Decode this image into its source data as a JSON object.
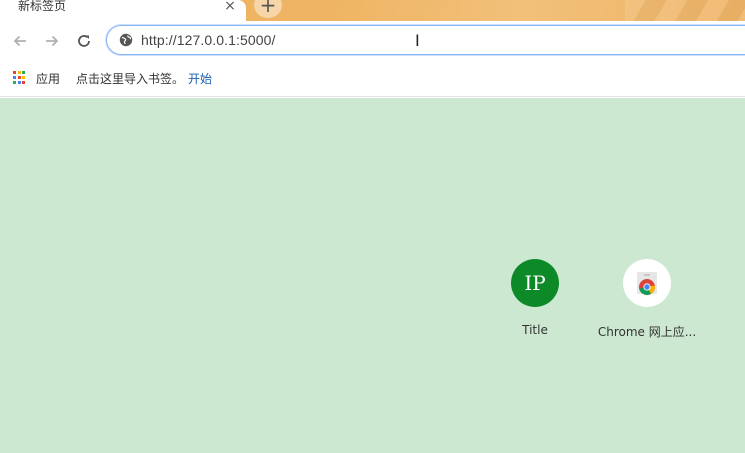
{
  "tab": {
    "title": "新标签页",
    "close_glyph": "×"
  },
  "newtab": {
    "glyph": "+"
  },
  "omnibox": {
    "url": "http://127.0.0.1:5000/",
    "caret_glyph": "I"
  },
  "bookmarks": {
    "apps_label": "应用",
    "import_text": "点击这里导入书签。",
    "start_link": "开始"
  },
  "tiles": [
    {
      "label": "Title",
      "initials": "IP",
      "color": "#0d8a27"
    },
    {
      "label": "Chrome 网上应...",
      "icon": "chrome-web-store-icon"
    }
  ],
  "colors": {
    "page_bg": "#cde8d0",
    "omnibox_border": "#8ab4f8",
    "link": "#1a5fb4"
  }
}
